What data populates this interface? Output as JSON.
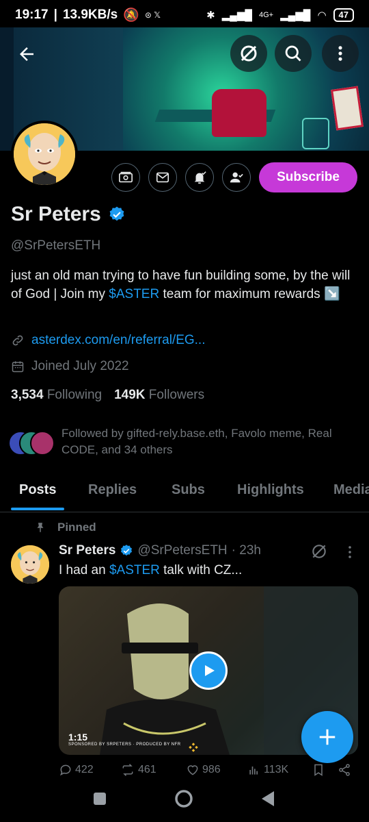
{
  "status_bar": {
    "time": "19:17",
    "speed": "13.9KB/s",
    "network": "4G+",
    "battery": "47"
  },
  "profile": {
    "name": "Sr Peters",
    "handle": "@SrPetersETH",
    "bio_part1": "just an old man trying to have fun building some, by the will of God | Join my ",
    "bio_link": "$ASTER",
    "bio_part2": " team for maximum rewards ",
    "bio_emoji": "↘️",
    "website": "asterdex.com/en/referral/EG...",
    "joined": "Joined July 2022",
    "following_count": "3,534",
    "following_label": "Following",
    "followers_count": "149K",
    "followers_label": "Followers",
    "followed_by": "Followed by gifted-rely.base.eth, Favolo meme, Real CODE, and 34 others",
    "subscribe_label": "Subscribe"
  },
  "tabs": [
    {
      "label": "Posts"
    },
    {
      "label": "Replies"
    },
    {
      "label": "Subs"
    },
    {
      "label": "Highlights"
    },
    {
      "label": "Media"
    }
  ],
  "post": {
    "pinned_label": "Pinned",
    "author": "Sr Peters",
    "handle": "@SrPetersETH",
    "time": "· 23h",
    "text_prefix": "I had an ",
    "text_link": "$ASTER",
    "text_suffix": " talk with CZ...",
    "duration": "1:15",
    "video_credit": "SPONSORED BY SRPETERS · PRODUCED BY NFR",
    "replies": "422",
    "reposts": "461",
    "likes": "986",
    "views": "113K"
  },
  "colors": {
    "accent": "#1d9bf0",
    "subscribe": "#c639d8",
    "muted": "#71767b",
    "background": "#000000"
  }
}
